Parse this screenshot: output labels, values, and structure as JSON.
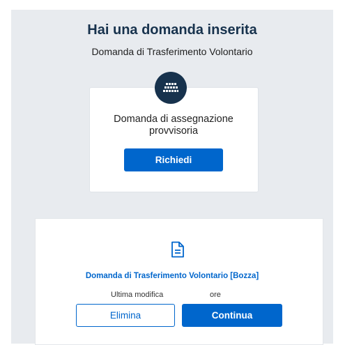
{
  "header": {
    "title": "Hai una domanda inserita",
    "subtitle": "Domanda di Trasferimento Volontario"
  },
  "request_card": {
    "icon": "keyboard-icon",
    "title": "Domanda di assegnazione provvisoria",
    "button_label": "Richiedi"
  },
  "draft_card": {
    "icon": "document-icon",
    "title": "Domanda di Trasferimento Volontario [Bozza]",
    "last_modified_label": "Ultima modifica",
    "last_modified_suffix": "ore",
    "delete_label": "Elimina",
    "continue_label": "Continua"
  },
  "colors": {
    "primary": "#0066cc",
    "dark": "#17324d",
    "background": "#e8ebef"
  }
}
